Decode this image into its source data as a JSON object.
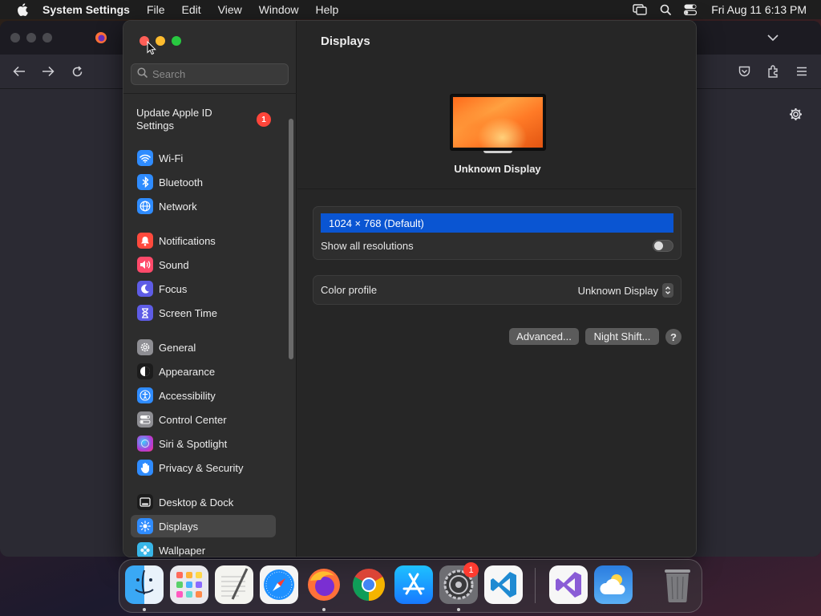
{
  "menubar": {
    "app_name": "System Settings",
    "items": [
      "File",
      "Edit",
      "View",
      "Window",
      "Help"
    ],
    "clock": "Fri Aug 11  6:13 PM"
  },
  "sidebar": {
    "search_placeholder": "Search",
    "apple_id_label": "Update Apple ID Settings",
    "apple_id_badge": "1",
    "items": [
      {
        "label": "Wi-Fi",
        "icon": "wifi-icon",
        "color": "#2f8cff"
      },
      {
        "label": "Bluetooth",
        "icon": "bluetooth-icon",
        "color": "#2f8cff"
      },
      {
        "label": "Network",
        "icon": "globe-icon",
        "color": "#2f8cff"
      },
      {
        "label": "Notifications",
        "icon": "bell-icon",
        "color": "#ff4a3d"
      },
      {
        "label": "Sound",
        "icon": "speaker-icon",
        "color": "#ff4a6a"
      },
      {
        "label": "Focus",
        "icon": "moon-icon",
        "color": "#5e5ce6"
      },
      {
        "label": "Screen Time",
        "icon": "hourglass-icon",
        "color": "#5e5ce6"
      },
      {
        "label": "General",
        "icon": "gear-icon",
        "color": "#8e8e93"
      },
      {
        "label": "Appearance",
        "icon": "appearance-icon",
        "color": "#1c1c1c"
      },
      {
        "label": "Accessibility",
        "icon": "accessibility-icon",
        "color": "#2f8cff"
      },
      {
        "label": "Control Center",
        "icon": "switches-icon",
        "color": "#8e8e93"
      },
      {
        "label": "Siri & Spotlight",
        "icon": "siri-icon",
        "color": "#b03cd8"
      },
      {
        "label": "Privacy & Security",
        "icon": "hand-icon",
        "color": "#2f8cff"
      },
      {
        "label": "Desktop & Dock",
        "icon": "dock-icon",
        "color": "#1c1c1c"
      },
      {
        "label": "Displays",
        "icon": "sun-icon",
        "color": "#2f8cff",
        "selected": true
      },
      {
        "label": "Wallpaper",
        "icon": "flower-icon",
        "color": "#38b6e8"
      }
    ]
  },
  "main": {
    "title": "Displays",
    "display_name": "Unknown Display",
    "resolution": "1024 × 768 (Default)",
    "show_all_label": "Show all resolutions",
    "show_all_enabled": false,
    "color_profile_label": "Color profile",
    "color_profile_value": "Unknown Display",
    "advanced_button": "Advanced...",
    "night_shift_button": "Night Shift...",
    "help_button": "?"
  },
  "dock": {
    "apps": [
      "finder-icon",
      "launchpad-icon",
      "textedit-icon",
      "safari-icon",
      "firefox-icon",
      "chrome-icon",
      "app-store-icon",
      "system-settings-icon",
      "vscode-icon",
      "visual-studio-icon",
      "weather-icon",
      "trash-icon"
    ],
    "settings_badge": "1"
  }
}
